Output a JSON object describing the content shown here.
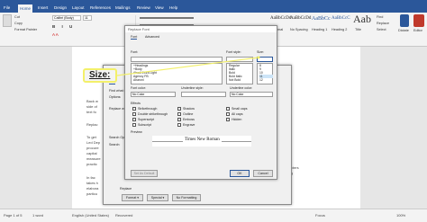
{
  "menu": {
    "tabs": [
      "File",
      "Home",
      "Insert",
      "Design",
      "Layout",
      "References",
      "Mailings",
      "Review",
      "View",
      "Help"
    ],
    "active": "Home"
  },
  "ribbon": {
    "clipboard": [
      "Cut",
      "Copy",
      "Format Painter"
    ],
    "font_name": "Calibri (Body)",
    "font_size": "11",
    "styles": [
      {
        "preview": "AaBbCcDd",
        "label": "Normal"
      },
      {
        "preview": "AaBbCcDd",
        "label": "No Spacing"
      },
      {
        "preview": "AaBbCc",
        "label": "Heading 1"
      },
      {
        "preview": "AaBbCcC",
        "label": "Heading 2"
      },
      {
        "preview": "Aab",
        "label": "Title"
      }
    ],
    "editing": [
      "Find",
      "Replace",
      "Select"
    ],
    "right_groups": [
      "Dictate",
      "Editor"
    ]
  },
  "find_replace": {
    "tabs": [
      "Find",
      "Replace",
      "Go To"
    ],
    "find_label": "Find what:",
    "options_label": "Options:",
    "replace_label": "Replace with:",
    "search_label": "Search Options",
    "search_value": "Search:",
    "replace_section": "Replace",
    "format_button": "Format ▾",
    "special_button": "Special ▾",
    "no_formatting_button": "No Formatting"
  },
  "font_dialog": {
    "title": "Replace Font",
    "tabs": [
      "Font",
      "Advanced"
    ],
    "font_label": "Font:",
    "style_label": "Font style:",
    "size_label": "Size:",
    "font_list": [
      "+Headings",
      "+Body",
      "Abadi Extra Light",
      "Agency FB",
      "Aharoni"
    ],
    "style_list": [
      "Regular",
      "Italic",
      "Bold",
      "Bold Italic",
      "Not Bold"
    ],
    "size_list": [
      "8",
      "9",
      "10",
      "11",
      "12"
    ],
    "selected_size": "11",
    "font_color_label": "Font color:",
    "font_color_value": "No Color",
    "underline_style_label": "Underline style:",
    "underline_color_label": "Underline color:",
    "underline_color_value": "No Color",
    "effects_label": "Effects",
    "effects": [
      "Strikethrough",
      "Double strikethrough",
      "Superscript",
      "Subscript",
      "Shadow",
      "Outline",
      "Emboss",
      "Engrave",
      "Small caps",
      "All caps",
      "Hidden"
    ],
    "preview_label": "Preview",
    "preview_text": "Times New Roman",
    "set_default_button": "Set As Default",
    "ok_button": "OK",
    "cancel_button": "Cancel"
  },
  "callout": {
    "text": "Size:"
  },
  "document": {
    "lines": [
      "Back w",
      "side of",
      "text fo",
      "",
      "Replac",
      "",
      "To get",
      "Led Dep",
      "procure",
      "capital",
      "measure",
      "practic",
      "",
      "In fac",
      "takes h",
      "elabora",
      "particu"
    ],
    "right_fragments": [
      "characters",
      "adding"
    ]
  },
  "status": {
    "page": "Page 1 of 5",
    "words": "1 word",
    "lang": "English (United States)",
    "mode": "Recovered",
    "focus": "Focus",
    "zoom": "100%"
  },
  "colors": {
    "brand": "#2b579a",
    "callout_border": "#f3f06a",
    "arrow": "#f3f06a"
  }
}
